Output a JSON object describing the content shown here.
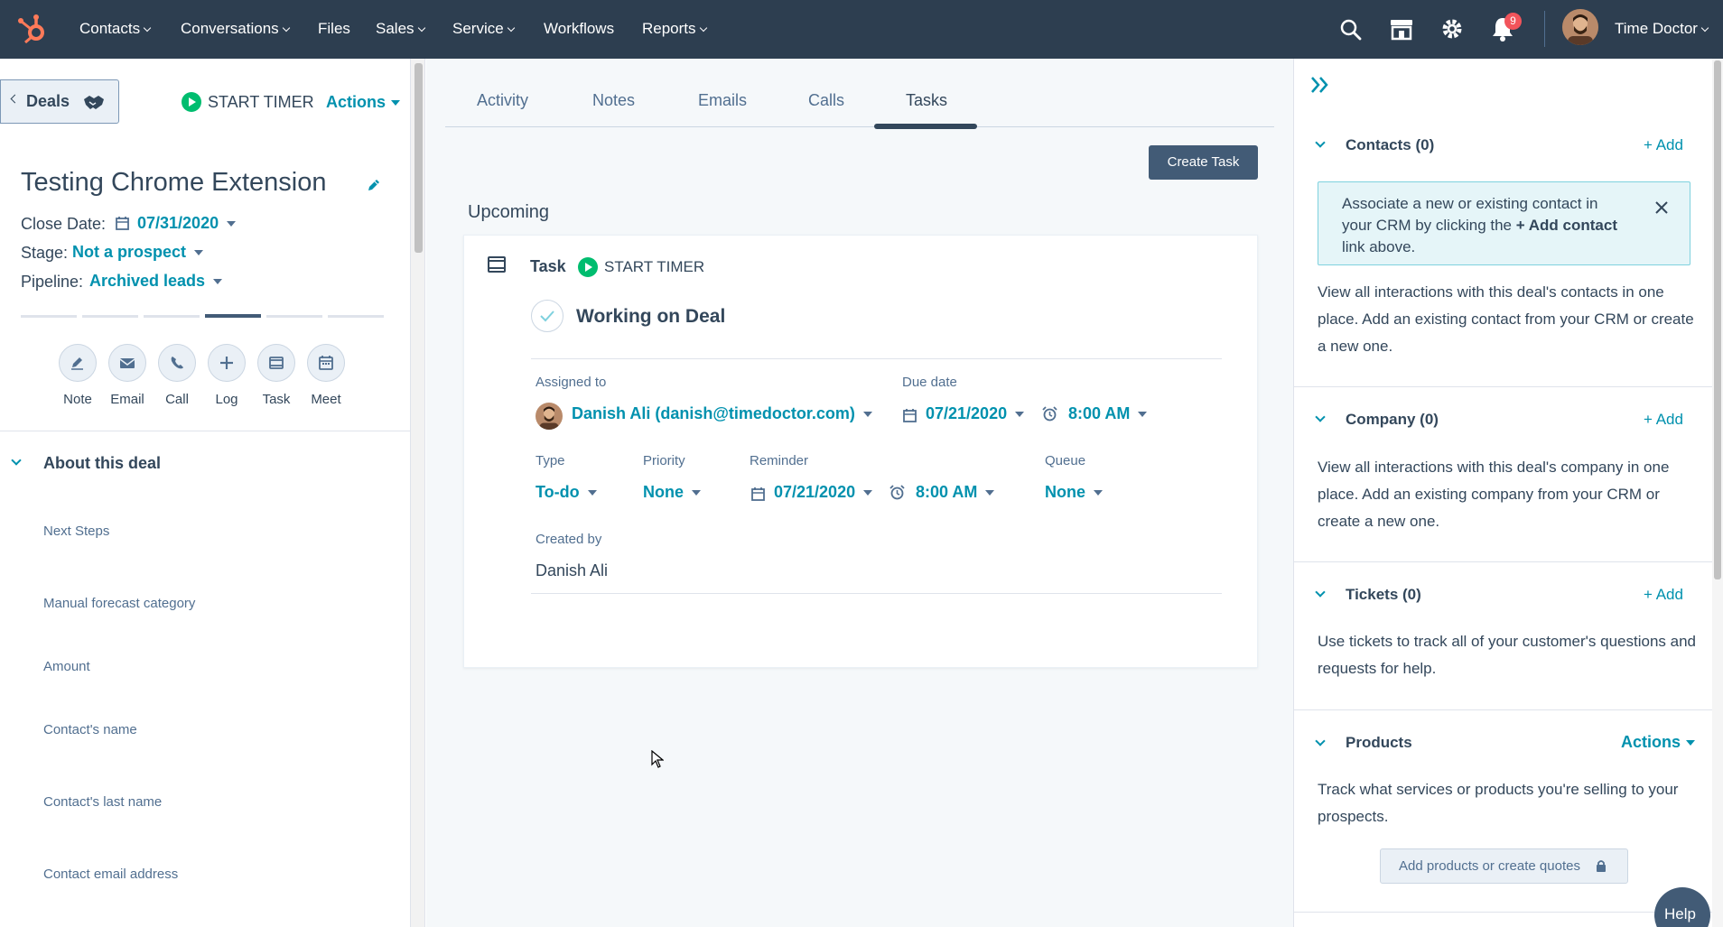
{
  "nav": {
    "items": [
      {
        "label": "Contacts",
        "dropdown": true
      },
      {
        "label": "Conversations",
        "dropdown": true
      },
      {
        "label": "Files",
        "dropdown": false
      },
      {
        "label": "Sales",
        "dropdown": true
      },
      {
        "label": "Service",
        "dropdown": true
      },
      {
        "label": "Workflows",
        "dropdown": false
      },
      {
        "label": "Reports",
        "dropdown": true
      }
    ],
    "notification_count": "9",
    "account_name": "Time Doctor"
  },
  "left": {
    "back_label": "Deals",
    "start_timer": "START TIMER",
    "actions_label": "Actions",
    "deal_title": "Testing Chrome Extension",
    "close_date_label": "Close Date:",
    "close_date_value": "07/31/2020",
    "stage_label": "Stage:",
    "stage_value": "Not a prospect",
    "pipeline_label": "Pipeline:",
    "pipeline_value": "Archived leads",
    "stage_progress": {
      "total_steps": 6,
      "current_step": 4
    },
    "quick_actions": [
      {
        "label": "Note",
        "icon": "edit-icon"
      },
      {
        "label": "Email",
        "icon": "email-icon"
      },
      {
        "label": "Call",
        "icon": "phone-icon"
      },
      {
        "label": "Log",
        "icon": "plus-icon"
      },
      {
        "label": "Task",
        "icon": "task-icon"
      },
      {
        "label": "Meet",
        "icon": "calendar-icon"
      }
    ],
    "about_title": "About this deal",
    "properties": [
      "Next Steps",
      "Manual forecast category",
      "Amount",
      "Contact's name",
      "Contact's last name",
      "Contact email address"
    ]
  },
  "middle": {
    "tabs": [
      "Activity",
      "Notes",
      "Emails",
      "Calls",
      "Tasks"
    ],
    "active_tab": "Tasks",
    "create_task_label": "Create Task",
    "upcoming_label": "Upcoming",
    "task": {
      "type_label": "Task",
      "start_timer": "START TIMER",
      "title": "Working on Deal",
      "assigned_to_label": "Assigned to",
      "assigned_to_value": "Danish Ali (danish@timedoctor.com)",
      "due_date_label": "Due date",
      "due_date_value": "07/21/2020",
      "due_time_value": "8:00 AM",
      "type_field_label": "Type",
      "type_value": "To-do",
      "priority_label": "Priority",
      "priority_value": "None",
      "reminder_label": "Reminder",
      "reminder_date": "07/21/2020",
      "reminder_time": "8:00 AM",
      "queue_label": "Queue",
      "queue_value": "None",
      "created_by_label": "Created by",
      "created_by_value": "Danish Ali"
    }
  },
  "right": {
    "contacts_title": "Contacts (0)",
    "contacts_add": "+ Add",
    "contacts_alert_pre": "Associate a new or existing contact in your CRM by clicking the ",
    "contacts_alert_bold": "+ Add contact",
    "contacts_alert_post": " link above.",
    "contacts_body": "View all interactions with this deal's contacts in one place. Add an existing contact from your CRM or create a new one.",
    "company_title": "Company (0)",
    "company_add": "+ Add",
    "company_body": "View all interactions with this deal's company in one place. Add an existing company from your CRM or create a new one.",
    "tickets_title": "Tickets (0)",
    "tickets_add": "+ Add",
    "tickets_body": "Use tickets to track all of your customer's questions and requests for help.",
    "products_title": "Products",
    "products_actions": "Actions",
    "products_body": "Track what services or products you're selling to your prospects.",
    "products_button": "Add products or create quotes",
    "help_label": "Help"
  },
  "colors": {
    "nav_bg": "#2d3e50",
    "accent": "#0091ae",
    "brand": "#ff7a59",
    "timer_green": "#00bd6f",
    "button_dark": "#425b76"
  }
}
